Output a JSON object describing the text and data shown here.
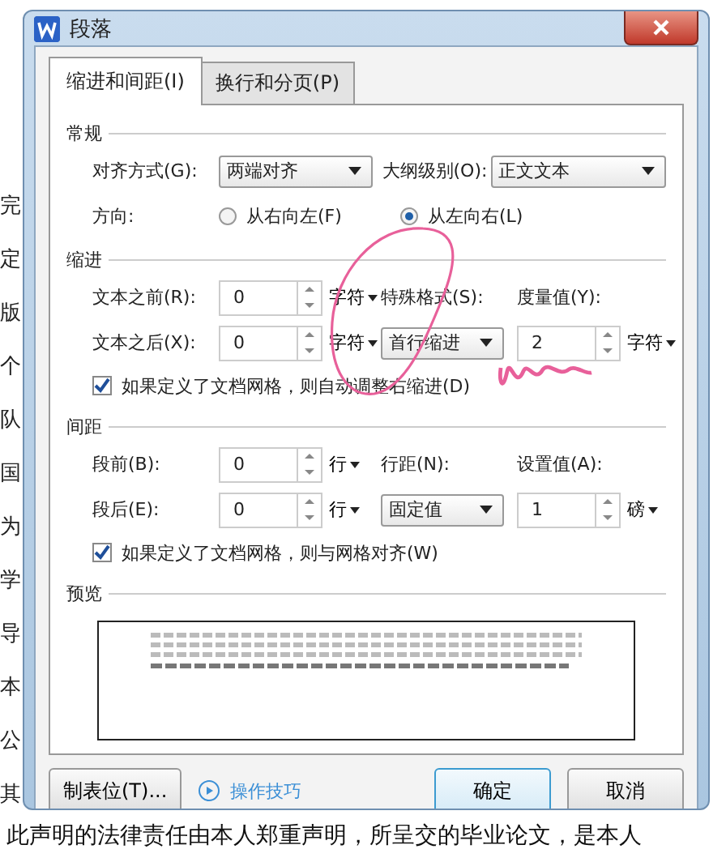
{
  "background": {
    "margin_chars": [
      "完",
      "定",
      "版",
      "个",
      "队",
      "国",
      "为",
      "学",
      "导",
      "本",
      "公",
      "其"
    ],
    "bottom_line": "此声明的法律责任由本人郑重声明，所呈交的毕业论文，是本人"
  },
  "window": {
    "title": "段落"
  },
  "tabs": [
    {
      "label": "缩进和间距(I)",
      "selected": true
    },
    {
      "label": "换行和分页(P)",
      "selected": false
    }
  ],
  "general": {
    "heading": "常规",
    "alignment": {
      "label": "对齐方式(G):",
      "value": "两端对齐"
    },
    "outline_level": {
      "label": "大纲级别(O):",
      "value": "正文文本"
    },
    "direction": {
      "label": "方向:",
      "options": [
        {
          "label": "从右向左(F)",
          "selected": false
        },
        {
          "label": "从左向右(L)",
          "selected": true
        }
      ]
    }
  },
  "indent": {
    "heading": "缩进",
    "before": {
      "label": "文本之前(R):",
      "value": "0",
      "unit": "字符"
    },
    "after": {
      "label": "文本之后(X):",
      "value": "0",
      "unit": "字符"
    },
    "special": {
      "label": "特殊格式(S):",
      "value": "首行缩进"
    },
    "measure": {
      "label": "度量值(Y):",
      "value": "2",
      "unit": "字符"
    },
    "grid_check": {
      "label": "如果定义了文档网格，则自动调整右缩进(D)",
      "checked": true
    }
  },
  "spacing": {
    "heading": "间距",
    "before": {
      "label": "段前(B):",
      "value": "0",
      "unit": "行"
    },
    "after": {
      "label": "段后(E):",
      "value": "0",
      "unit": "行"
    },
    "special": {
      "label": "行距(N):",
      "value": "固定值"
    },
    "measure": {
      "label": "设置值(A):",
      "value": "1",
      "unit": "磅"
    },
    "grid_check": {
      "label": "如果定义了文档网格，则与网格对齐(W)",
      "checked": true
    }
  },
  "preview": {
    "heading": "预览"
  },
  "footer": {
    "tabs_button": "制表位(T)...",
    "tips_link": "操作技巧",
    "ok": "确定",
    "cancel": "取消"
  }
}
